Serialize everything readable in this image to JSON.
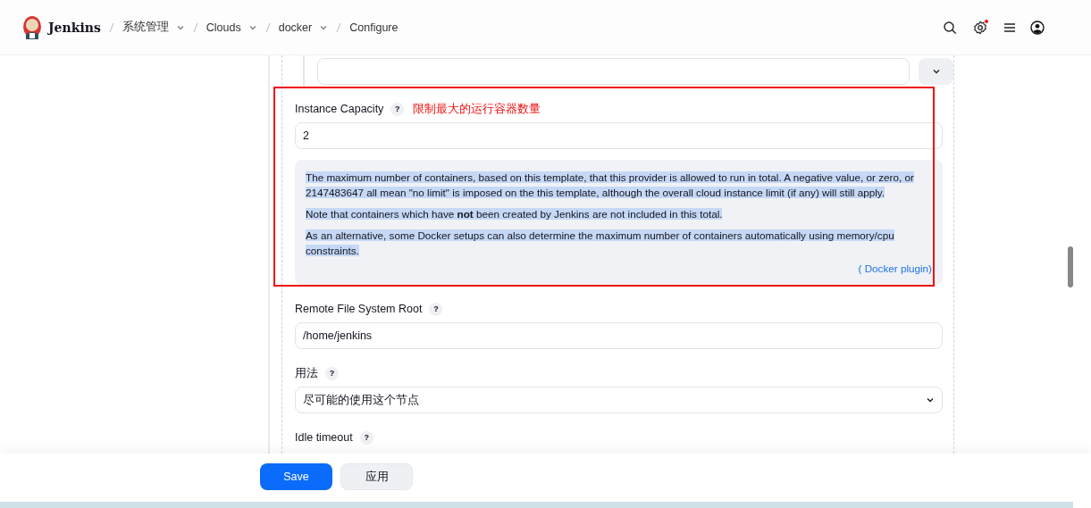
{
  "header": {
    "logo_text": "Jenkins",
    "breadcrumbs": [
      {
        "label": "系统管理",
        "dropdown": true
      },
      {
        "label": "Clouds",
        "dropdown": true
      },
      {
        "label": "docker",
        "dropdown": true
      },
      {
        "label": "Configure",
        "dropdown": false
      }
    ],
    "settings_notification": true
  },
  "form": {
    "fields": [
      {
        "kind": "text",
        "label": "Instance Capacity",
        "help_button": "?",
        "annotation": "限制最大的运行容器数量",
        "value": "2",
        "help": {
          "paragraphs": [
            "The maximum number of containers, based on this template, that this provider is allowed to run in total. A negative value, or zero, or 2147483647 all mean \"no limit\" is imposed on the this template, although the overall cloud instance limit (if any) will still apply.",
            "Note that containers which have **not** been created by Jenkins are not included in this total.",
            "As an alternative, some Docker setups can also determine the maximum number of containers automatically using memory/cpu constraints."
          ],
          "source": "( Docker plugin)"
        }
      },
      {
        "kind": "text",
        "label": "Remote File System Root",
        "help_button": "?",
        "value": "/home/jenkins"
      },
      {
        "kind": "select",
        "label": "用法",
        "help_button": "?",
        "value": "尽可能的使用这个节点"
      },
      {
        "kind": "label",
        "label": "Idle timeout",
        "help_button": "?"
      }
    ]
  },
  "buttons": [
    {
      "label": "Save",
      "kind": "primary"
    },
    {
      "label": "应用",
      "kind": "secondary"
    }
  ]
}
